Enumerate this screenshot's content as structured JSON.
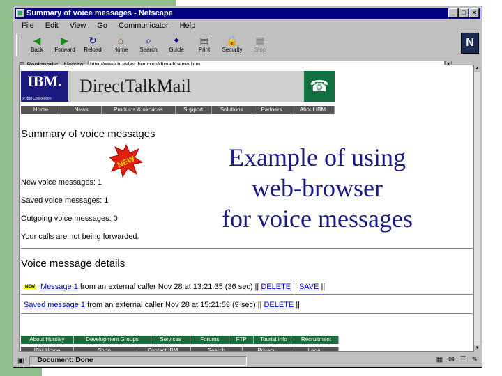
{
  "window": {
    "title": "Summary of voice messages - Netscape",
    "buttons": [
      "_",
      "□",
      "×"
    ]
  },
  "menu": [
    "File",
    "Edit",
    "View",
    "Go",
    "Communicator",
    "Help"
  ],
  "toolbar": [
    {
      "label": "Back",
      "icon": "back-arrow-icon",
      "glyph": "◀",
      "color": "#1a8a1a",
      "disabled": false
    },
    {
      "label": "Forward",
      "icon": "forward-arrow-icon",
      "glyph": "▶",
      "color": "#1a8a1a",
      "disabled": false
    },
    {
      "label": "Reload",
      "icon": "reload-icon",
      "glyph": "↻",
      "color": "#000080",
      "disabled": false
    },
    {
      "label": "Home",
      "icon": "home-icon",
      "glyph": "⌂",
      "color": "#8a4a1a",
      "disabled": false
    },
    {
      "label": "Search",
      "icon": "search-icon",
      "glyph": "⌕",
      "color": "#000080",
      "disabled": false
    },
    {
      "label": "Guide",
      "icon": "guide-icon",
      "glyph": "✦",
      "color": "#000080",
      "disabled": false
    },
    {
      "label": "Print",
      "icon": "print-icon",
      "glyph": "▤",
      "color": "#404040",
      "disabled": false
    },
    {
      "label": "Security",
      "icon": "lock-icon",
      "glyph": "🔒",
      "color": "#a02020",
      "disabled": false
    },
    {
      "label": "Stop",
      "icon": "stop-icon",
      "glyph": "▦",
      "color": "#808080",
      "disabled": true
    }
  ],
  "location": {
    "bookmarks_label": "Bookmarks",
    "netsite_label": "Netsite:",
    "url": "http://www.hursley.ibm.com/dtmail/demo.htm"
  },
  "header": {
    "ibm_logo_text": "IBM.",
    "ibm_corp": "© IBM Corporation",
    "product_name": "DirectTalkMail"
  },
  "topnav": [
    "Home",
    "News",
    "Products & services",
    "Support",
    "Solutions",
    "Partners",
    "About IBM"
  ],
  "summary": {
    "heading": "Summary of voice messages",
    "badge": "NEW",
    "lines": [
      "New voice messages: 1",
      "Saved voice messages: 1",
      "Outgoing voice messages: 0",
      "Your calls are not being forwarded."
    ]
  },
  "details": {
    "heading": "Voice message details",
    "new_badge": "NEW",
    "message1": {
      "link": "Message 1",
      "text": " from an external caller Nov 28 at 13:21:35 (36 sec) || ",
      "delete": "DELETE",
      "sep": " || ",
      "save": "SAVE",
      "end": " ||"
    },
    "message2": {
      "link": "Saved message 1",
      "text": " from an external caller Nov 28 at 15:21:53 (9 sec) || ",
      "delete": "DELETE",
      "end": " ||"
    }
  },
  "bottomnav1": [
    "About Hursley",
    "Development Groups",
    "Services",
    "Forums",
    "FTP",
    "Tourist info",
    "Recruitment"
  ],
  "bottomnav2": [
    "IBM Home",
    "Shop",
    "Contact IBM",
    "Search",
    "Privacy",
    "Legal"
  ],
  "status": "Document: Done",
  "overlay": {
    "line1": "Example of using",
    "line2": "web-browser",
    "line3": "for voice messages"
  },
  "colors": {
    "green_strip": "#8fbf8a",
    "overlay_text": "#1a1a80",
    "link": "#0000cc"
  }
}
